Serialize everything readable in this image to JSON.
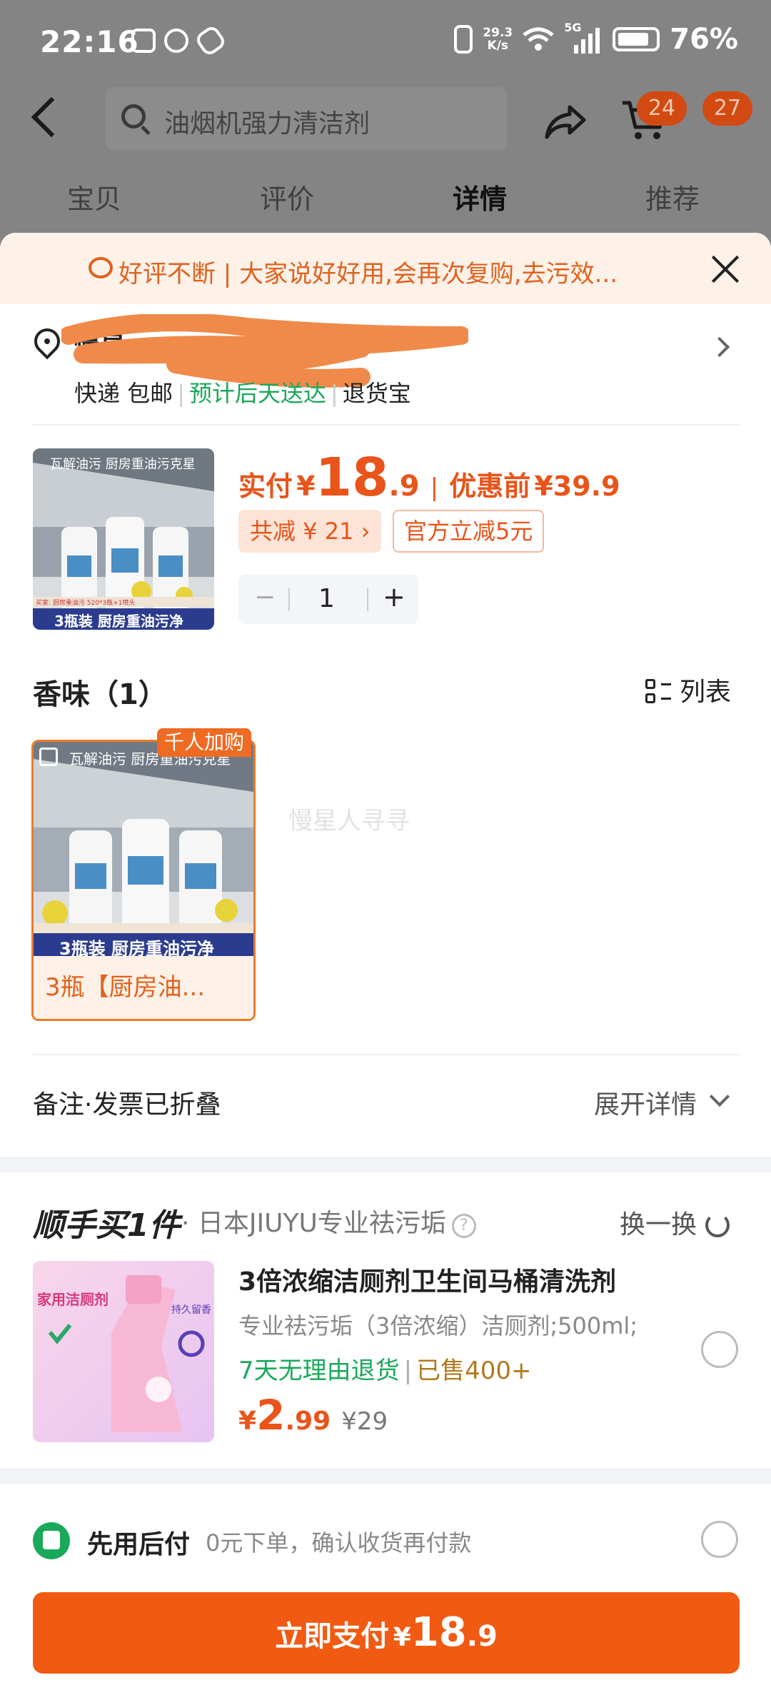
{
  "status_bar": {
    "time": "22:16",
    "network_speed_value": "29.3",
    "network_speed_unit": "K/s",
    "signal": "5G",
    "battery": "76%"
  },
  "header": {
    "search_placeholder": "油烟机强力清洁剂",
    "cart_badge": "24",
    "more_badge": "27",
    "tabs": [
      {
        "label": "宝贝"
      },
      {
        "label": "评价"
      },
      {
        "label": "详情"
      },
      {
        "label": "推荐"
      }
    ]
  },
  "notice": {
    "text": "好评不断 | 大家说好好用,会再次复购,去污效..."
  },
  "address": {
    "line1": "慢星                 ",
    "shipping": "快递 包邮",
    "delivery": "预计后天送达",
    "returns": "退货宝"
  },
  "product": {
    "image_caption_top": "瓦解油污 厨房重油污克星",
    "image_caption_bottom": "3瓶装 厨房重油污净",
    "image_small_text": "买家: 厨房重油污 520*3瓶+1喷头",
    "paid_label": "实付",
    "currency": "¥",
    "price_int": "18",
    "price_dec": ".9",
    "before_label": "优惠前",
    "before_price": "¥39.9",
    "discount_tag": "共减 ¥ 21",
    "official_tag": "官方立减5元",
    "quantity": "1",
    "minus": "−",
    "plus": "+"
  },
  "variants": {
    "section_title": "香味（1）",
    "list_label": "列表",
    "items": [
      {
        "name": "3瓶【厨房油...",
        "hot_label": "千人加购",
        "caption_top": "瓦解油污 厨房重油污克星",
        "caption_bottom": "3瓶装 厨房重油污净"
      }
    ],
    "watermark": "慢星人寻寻"
  },
  "remarks": {
    "label": "备注·发票已折叠",
    "expand_label": "展开详情"
  },
  "upsell": {
    "title": "顺手买1件",
    "subtitle": "日本JIUYU专业祛污垢",
    "swap_label": "换一换",
    "name": "3倍浓缩洁厕剂卫生间马桶清洗剂",
    "spec": "专业祛污垢（3倍浓缩）洁厕剂;500ml;",
    "return_tag": "7天无理由退货",
    "sold": "已售400+",
    "currency": "¥",
    "price_int": "2",
    "price_dec": ".99",
    "orig_price": "¥29",
    "image_text_1": "家用洁厕剂",
    "image_text_2": "持久留香"
  },
  "pay_later": {
    "title": "先用后付",
    "desc": "0元下单，确认收货再付款"
  },
  "pay_button": {
    "label": "立即支付",
    "currency": "¥",
    "price_int": "18",
    "price_dec": ".9"
  },
  "colors": {
    "accent": "#f15a12",
    "green": "#1aa85b",
    "notice_bg": "#fdf1e8"
  }
}
